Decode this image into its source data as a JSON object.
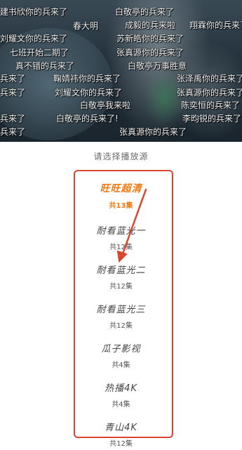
{
  "danmaku": [
    "建书欣你的兵来了",
    "白敬亭的兵来了",
    "刘耀文你的兵来了",
    "春大明",
    "成毅的兵来啦",
    "翔霖你的兵来了",
    "苏新皓你的兵来了",
    "张真源你的兵来了",
    "七班开始二期了",
    "白敬亭万事胜意",
    "真不错的兵来了",
    "刘耀文你的兵来了",
    "鞠婧祎你的兵来了",
    "张泽禹你的兵来了",
    "张真源你的兵来了",
    "白敬亭我来啦",
    "陈奕恒的兵来了",
    "白敬亭的兵来了!",
    "李昀锐的兵来了",
    "张真源你的兵来了",
    "兵来了",
    "兵来了",
    "兵来了",
    "兵来了"
  ],
  "source_panel": {
    "title": "请选择播放源",
    "sources": [
      {
        "name": "旺旺超清",
        "count": "共13集",
        "selected": true
      },
      {
        "name": "耐看蓝光一",
        "count": "共12集",
        "selected": false
      },
      {
        "name": "耐看蓝光二",
        "count": "共12集",
        "selected": false
      },
      {
        "name": "耐看蓝光三",
        "count": "共12集",
        "selected": false
      },
      {
        "name": "瓜子影视",
        "count": "共4集",
        "selected": false
      },
      {
        "name": "热播4K",
        "count": "共4集",
        "selected": false
      },
      {
        "name": "青山4K",
        "count": "共12集",
        "selected": false
      }
    ]
  },
  "colors": {
    "accent": "#f07a13",
    "annotation": "#d9462e"
  }
}
